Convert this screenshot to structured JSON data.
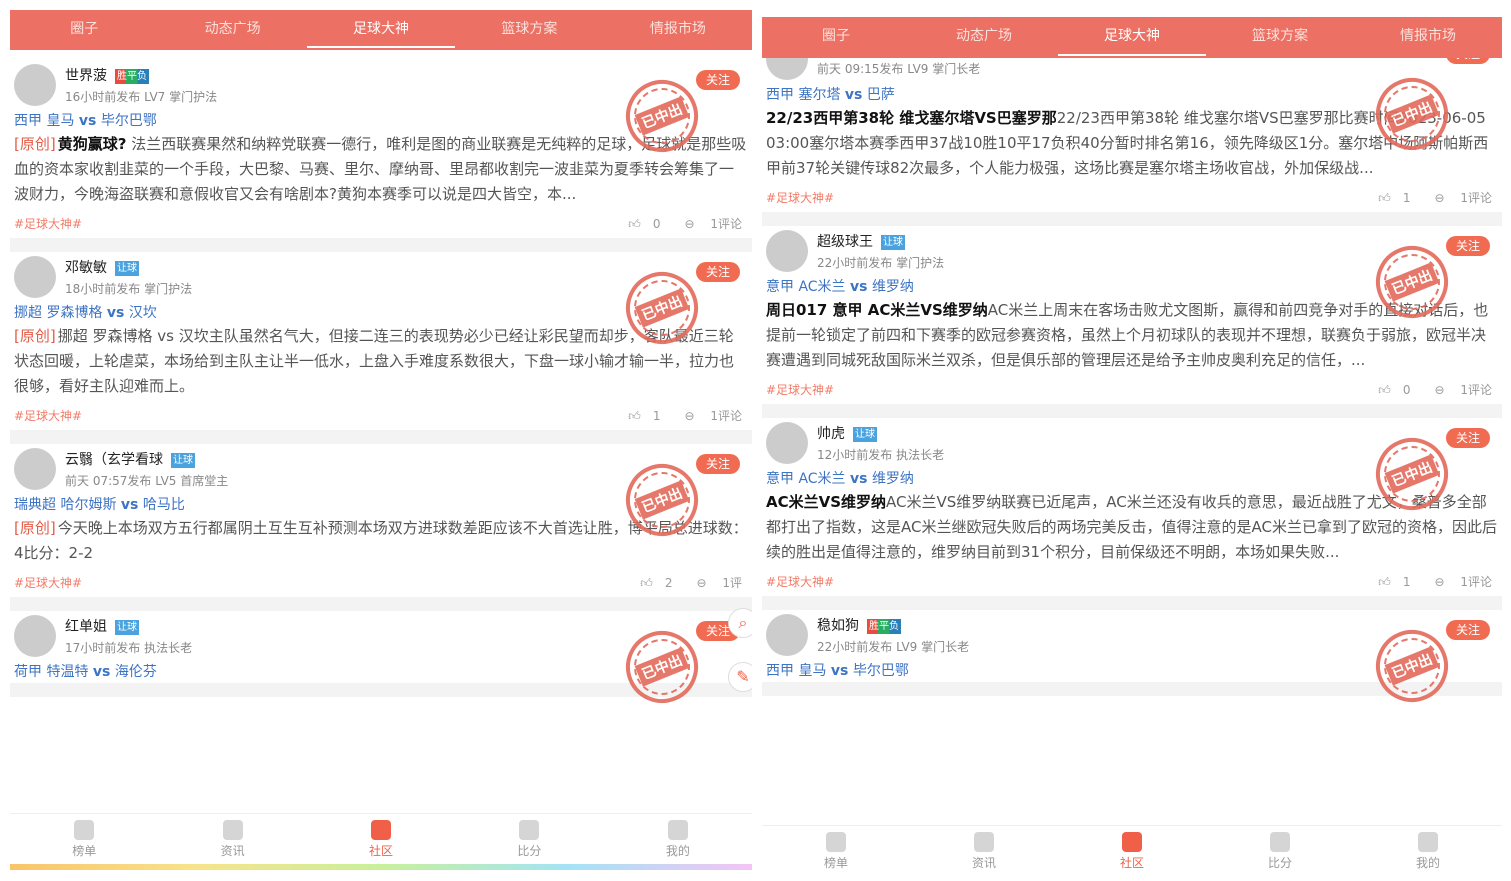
{
  "tabs": [
    "圈子",
    "动态广场",
    "足球大神",
    "篮球方案",
    "情报市场"
  ],
  "active_tab": 2,
  "bottom_nav": [
    "榜单",
    "资讯",
    "社区",
    "比分",
    "我的"
  ],
  "active_nav": 2,
  "stamp_text": "已中出",
  "follow_label": "关注",
  "left_posts": [
    {
      "user": "世界菠",
      "badge": "胜平负",
      "time": "16小时前发布",
      "level": "LV7 掌门护法",
      "league": "西甲",
      "home": "皇马",
      "vs": "vs",
      "away": "毕尔巴鄂",
      "orig": "[原创]",
      "title": "黄狗赢球?",
      "text": " 法兰西联赛果然和纳粹党联赛一德行，唯利是图的商业联赛是无纯粹的足球，足球就是那些吸血的资本家收割韭菜的一个手段，大巴黎、马赛、里尔、摩纳哥、里昂都收割完一波韭菜为夏季转会筹集了一波财力，今晚海盗联赛和意假收官又会有啥剧本?黄狗本赛季可以说是四大皆空，本...",
      "tag": "#足球大神#",
      "likes": "0",
      "comments": "1评论"
    },
    {
      "user": "邓敏敏",
      "badge": "让球",
      "time": "18小时前发布",
      "level": "掌门护法",
      "league": "挪超",
      "home": "罗森博格",
      "vs": "vs",
      "away": "汉坎",
      "orig": "[原创]",
      "title": "",
      "text": "挪超 罗森博格 vs 汉坎主队虽然名气大，但接二连三的表现势必少已经让彩民望而却步，客队最近三轮状态回暖，上轮虐菜，本场给到主队主让半一低水，上盘入手难度系数很大，下盘一球小输才输一半，拉力也很够，看好主队迎难而上。",
      "tag": "#足球大神#",
      "likes": "1",
      "comments": "1评论"
    },
    {
      "user": "云翳（玄学看球",
      "badge": "让球",
      "time": "前天 07:57发布",
      "level": "LV5 首席堂主",
      "league": "瑞典超",
      "home": "哈尔姆斯",
      "vs": "vs",
      "away": "哈马比",
      "orig": "[原创]",
      "title": "",
      "text": "今天晚上本场双方五行都属阴土互生互补预测本场双方进球数差距应该不大首选让胜，博平局总进球数：4比分：2-2",
      "tag": "#足球大神#",
      "likes": "2",
      "comments": "1评"
    },
    {
      "user": "红单姐",
      "badge": "让球",
      "time": "17小时前发布",
      "level": "执法长老",
      "league": "荷甲",
      "home": "特温特",
      "vs": "vs",
      "away": "海伦芬",
      "orig": "",
      "title": "",
      "text": "",
      "tag": "",
      "likes": "",
      "comments": ""
    }
  ],
  "right_posts": [
    {
      "user": "",
      "badge": "",
      "time": "前天 09:15发布",
      "level": "LV9 掌门长老",
      "league": "西甲",
      "home": "塞尔塔",
      "vs": "vs",
      "away": "巴萨",
      "orig": "",
      "title": "22/23西甲第38轮 维戈塞尔塔VS巴塞罗那",
      "text": "22/23西甲第38轮 维戈塞尔塔VS巴塞罗那比赛时间2023-06-05 03:00塞尔塔本赛季西甲37战10胜10平17负积40分暂时排名第16，领先降级区1分。塞尔塔中场阿斯帕斯西甲前37轮关键传球82次最多，个人能力极强，这场比赛是塞尔塔主场收官战，外加保级战...",
      "tag": "#足球大神#",
      "likes": "1",
      "comments": "1评论"
    },
    {
      "user": "超级球王",
      "badge": "让球",
      "time": "22小时前发布",
      "level": "掌门护法",
      "league": "意甲",
      "home": "AC米兰",
      "vs": "vs",
      "away": "维罗纳",
      "orig": "",
      "title": "周日017 意甲 AC米兰VS维罗纳",
      "text": "AC米兰上周末在客场击败尤文图斯，赢得和前四竞争对手的直接对话后，也提前一轮锁定了前四和下赛季的欧冠参赛资格，虽然上个月初球队的表现并不理想，联赛负于弱旅，欧冠半决赛遭遇到同城死敌国际米兰双杀，但是俱乐部的管理层还是给予主帅皮奥利充足的信任，...",
      "tag": "#足球大神#",
      "likes": "0",
      "comments": "1评论"
    },
    {
      "user": "帅虎",
      "badge": "让球",
      "time": "12小时前发布",
      "level": "执法长老",
      "league": "意甲",
      "home": "AC米兰",
      "vs": "vs",
      "away": "维罗纳",
      "orig": "",
      "title": "AC米兰VS维罗纳",
      "text": "AC米兰VS维罗纳联赛已近尾声，AC米兰还没有收兵的意思，最近战胜了尤文，桑普多全部都打出了指数，这是AC米兰继欧冠失败后的两场完美反击，值得注意的是AC米兰已拿到了欧冠的资格，因此后续的胜出是值得注意的，维罗纳目前到31个积分，目前保级还不明朗，本场如果失败...",
      "tag": "#足球大神#",
      "likes": "1",
      "comments": "1评论"
    },
    {
      "user": "稳如狗",
      "badge": "胜平负",
      "time": "22小时前发布",
      "level": "LV9 掌门长老",
      "league": "西甲",
      "home": "皇马",
      "vs": "vs",
      "away": "毕尔巴鄂",
      "orig": "",
      "title": "",
      "text": "",
      "tag": "",
      "likes": "",
      "comments": ""
    }
  ]
}
